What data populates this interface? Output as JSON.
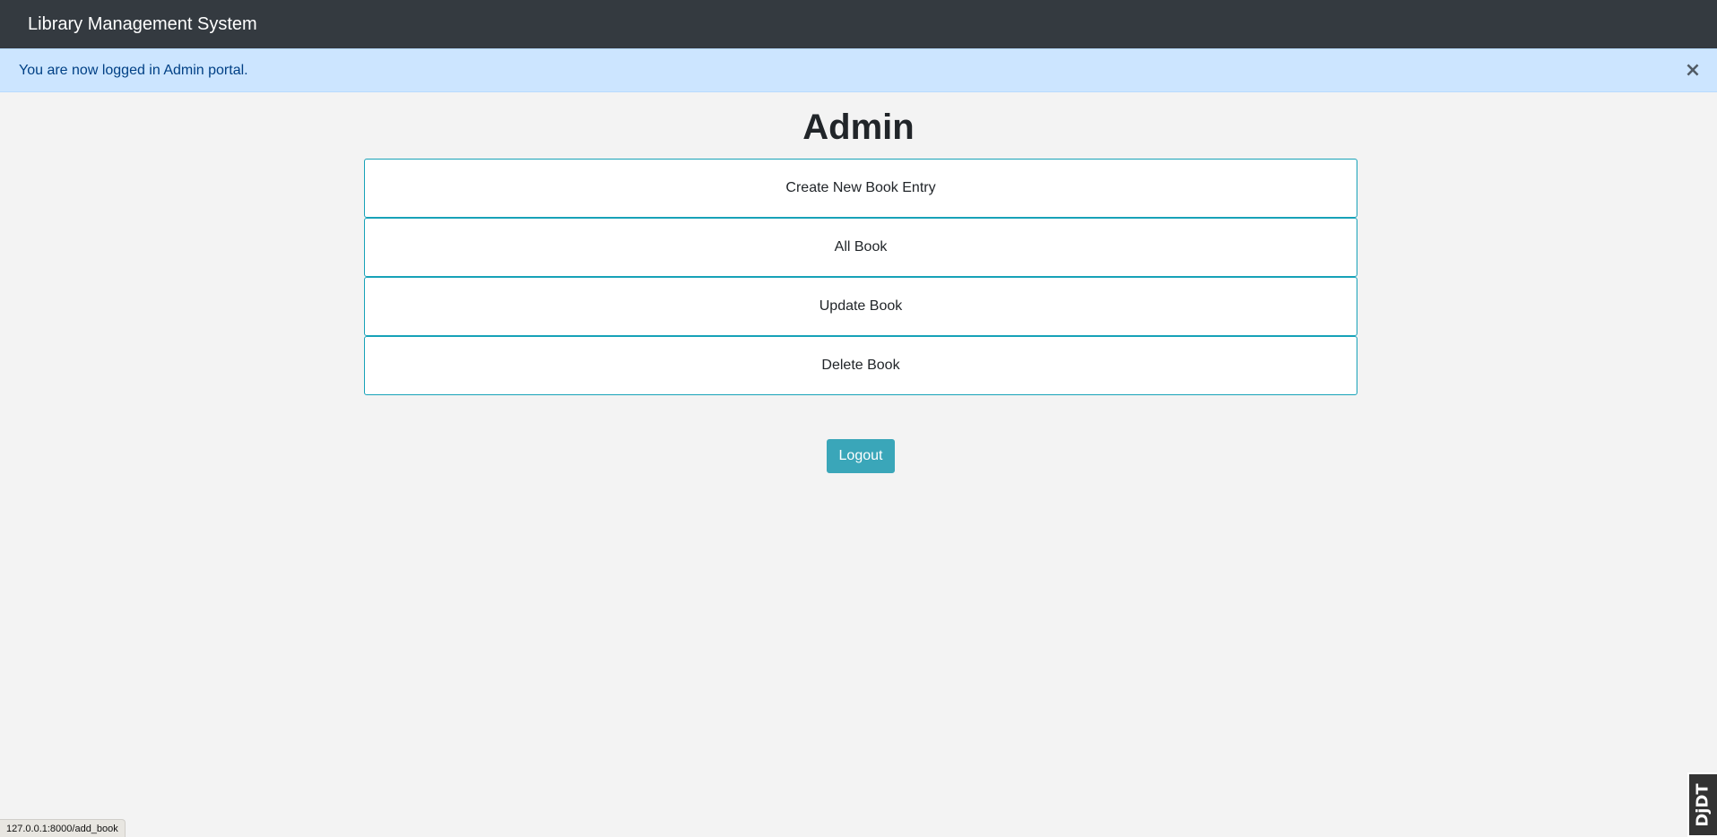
{
  "navbar": {
    "brand": "Library Management System"
  },
  "alert": {
    "message": "You are now logged in Admin portal.",
    "close_glyph": "×"
  },
  "page": {
    "title": "Admin"
  },
  "menu": {
    "items": [
      {
        "label": "Create New Book Entry"
      },
      {
        "label": "All Book"
      },
      {
        "label": "Update Book"
      },
      {
        "label": "Delete Book"
      }
    ]
  },
  "actions": {
    "logout_label": "Logout"
  },
  "status_bar": {
    "url": "127.0.0.1:8000/add_book"
  },
  "debug_toolbar": {
    "label": "DjDT"
  },
  "colors": {
    "navbar_bg": "#343a40",
    "alert_bg": "#cce5ff",
    "accent": "#17a2b8",
    "button_bg": "#3aa6b9"
  }
}
